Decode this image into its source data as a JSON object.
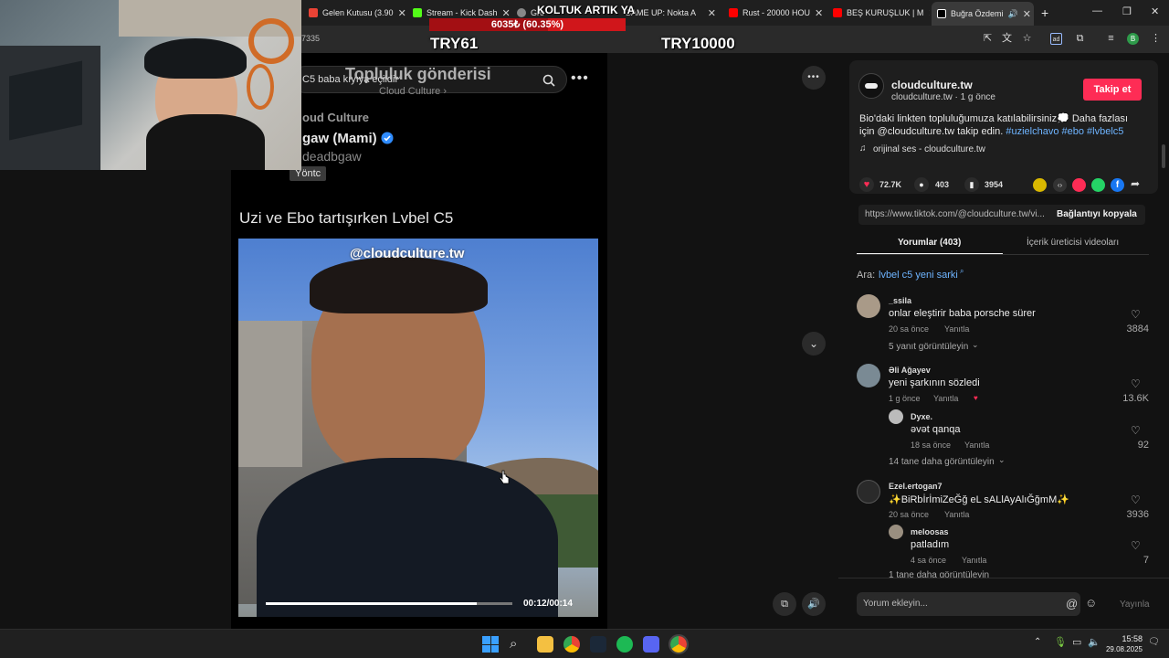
{
  "browser": {
    "tabs": [
      {
        "label": "Gelen Kutusu (3.90",
        "favicon_color": "#ea4335"
      },
      {
        "label": "Stream - Kick Dash",
        "favicon_color": "#53fc18"
      },
      {
        "label": "Gro",
        "favicon_color": "#888888"
      },
      {
        "label": "GAME UP: Nokta A",
        "favicon_color": "#7a7a7a"
      },
      {
        "label": "Rust - 20000 HOU",
        "favicon_color": "#ff0000"
      },
      {
        "label": "BEŞ KURUŞLUK | M",
        "favicon_color": "#ff0000"
      },
      {
        "label": "Buğra Özdemi",
        "favicon_color": "#ffffff"
      }
    ],
    "url_fragment": "7335",
    "profile_initial": "B"
  },
  "overlay": {
    "title": "KOLTUK ARTIK YA",
    "progress_text": "6035₺ (60.35%)",
    "progress": 0.6035,
    "goal_left": "TRY61",
    "goal_right": "TRY10000"
  },
  "post": {
    "search_text": "C5 baba kıyıya eçildir",
    "header_title": "Topluluk gönderisi",
    "header_sub": "Cloud Culture ›",
    "community": "oud Culture",
    "author_name": "gaw (Mami)",
    "author_handle": "deadbgaw",
    "role_badge": "Yöntc",
    "body": "Uzi ve Ebo tartışırken Lvbel C5",
    "video_watermark": "@cloudculture.tw",
    "video_time": "00:12/00:14",
    "video_progress": 0.857
  },
  "details": {
    "username": "cloudculture.tw",
    "meta": "cloudculture.tw · 1 g önce",
    "follow_label": "Takip et",
    "desc_main": "Bio'daki linkten topluluğumuza katılabilirsiniz💭 Daha fazlası için @cloudculture.tw takip edin. ",
    "desc_tags": "#uzielchavo #ebo #lvbelc5",
    "sound": "orijinal ses - cloudculture.tw",
    "likes": "72.7K",
    "comments": "403",
    "saves": "3954",
    "link_url": "https://www.tiktok.com/@cloudculture.tw/vi...",
    "copy_label": "Bağlantıyı kopyala",
    "tab_comments": "Yorumlar (403)",
    "tab_creator": "İçerik üreticisi videoları",
    "search_prefix": "Ara:",
    "search_query": "lvbel c5 yeni sarki",
    "comment_placeholder": "Yorum ekleyin...",
    "post_button": "Yayınla"
  },
  "comments": [
    {
      "user": "_ssila",
      "text": "onlar eleştirir baba porsche sürer",
      "time": "20 sa önce",
      "reply": "Yanıtla",
      "likes": "3884",
      "more": "5 yanıt görüntüleyin"
    },
    {
      "user": "Əli Ağayev",
      "text": "yeni şarkının sözledi",
      "time": "1 g önce",
      "reply": "Yanıtla",
      "likes": "13.6K"
    },
    {
      "user": "Dyxe.",
      "text": "əvət qanqa",
      "time": "18 sa önce",
      "reply": "Yanıtla",
      "likes": "92",
      "more": "14 tane daha görüntüleyin"
    },
    {
      "user": "Ezel.ertogan7",
      "text": "✨BiRbİrİmiZeĞğ eL sALlAyAlıĞğmM✨",
      "time": "20 sa önce",
      "reply": "Yanıtla",
      "likes": "3936"
    },
    {
      "user": "meloosas",
      "text": "patladım",
      "time": "4 sa önce",
      "reply": "Yanıtla",
      "likes": "7",
      "more": "1 tane daha görüntüleyin"
    }
  ],
  "taskbar": {
    "time": "15:58",
    "date": "29.08.2025"
  }
}
